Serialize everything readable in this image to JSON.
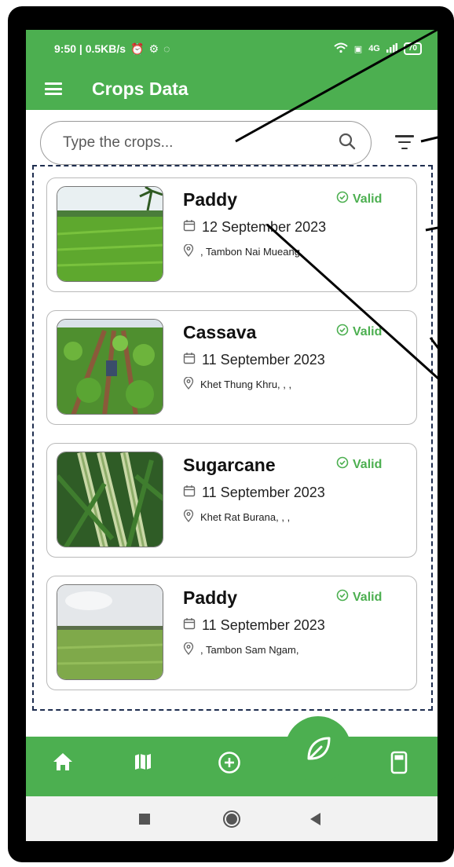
{
  "status_bar": {
    "time_and_speed": "9:50 | 0.5KB/s",
    "network_label": "4G",
    "battery": "70"
  },
  "app": {
    "title": "Crops Data"
  },
  "search": {
    "placeholder": "Type the crops..."
  },
  "crops": [
    {
      "name": "Paddy",
      "status": "Valid",
      "date": "12 September 2023",
      "location": ", Tambon Nai Mueang,"
    },
    {
      "name": "Cassava",
      "status": "Valid",
      "date": "11 September 2023",
      "location": "Khet Thung Khru, , ,"
    },
    {
      "name": "Sugarcane",
      "status": "Valid",
      "date": "11 September 2023",
      "location": "Khet Rat Burana, , ,"
    },
    {
      "name": "Paddy",
      "status": "Valid",
      "date": "11 September 2023",
      "location": ", Tambon Sam Ngam,"
    }
  ],
  "bottom_nav": {
    "items": [
      "home-icon",
      "map-icon",
      "add-icon",
      "leaf-icon",
      "device-icon"
    ]
  },
  "colors": {
    "primary": "#4caf50",
    "dashed_border": "#1e2d4f",
    "valid": "#4caf50"
  }
}
